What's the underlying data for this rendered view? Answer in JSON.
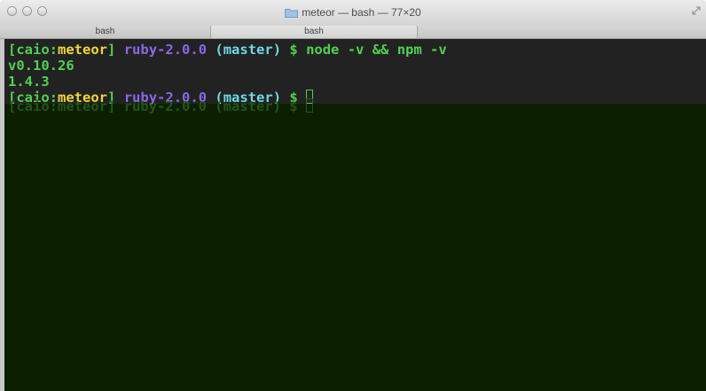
{
  "window": {
    "title": "meteor — bash — 77×20"
  },
  "tabs": [
    {
      "label": "bash"
    },
    {
      "label": "bash"
    }
  ],
  "terminal": {
    "lines": [
      {
        "bracket_open": "[",
        "user": "caio",
        "colon": ":",
        "dir": "meteor",
        "bracket_close": "]",
        "ruby": "ruby-2.0.0",
        "branch": "(master)",
        "prompt": "$",
        "command": "node -v && npm -v"
      }
    ],
    "output": [
      "v0.10.26",
      "1.4.3"
    ],
    "last_prompt": {
      "bracket_open": "[",
      "user": "caio",
      "colon": ":",
      "dir": "meteor",
      "bracket_close": "]",
      "ruby": "ruby-2.0.0",
      "branch": "(master)",
      "prompt": "$"
    },
    "ghost_text": "[caio:meteor] ruby-2.0.0 (master) $"
  },
  "colors": {
    "terminal_bg": "#222222",
    "terminal_bg_lower": "#0c2000",
    "prompt_green": "#50d050",
    "dir_yellow": "#f0d63a",
    "ruby_purple": "#8b66e6",
    "branch_cyan": "#6ed8e6"
  },
  "icons": {
    "folder": "folder-icon",
    "resize": "resize-icon"
  }
}
